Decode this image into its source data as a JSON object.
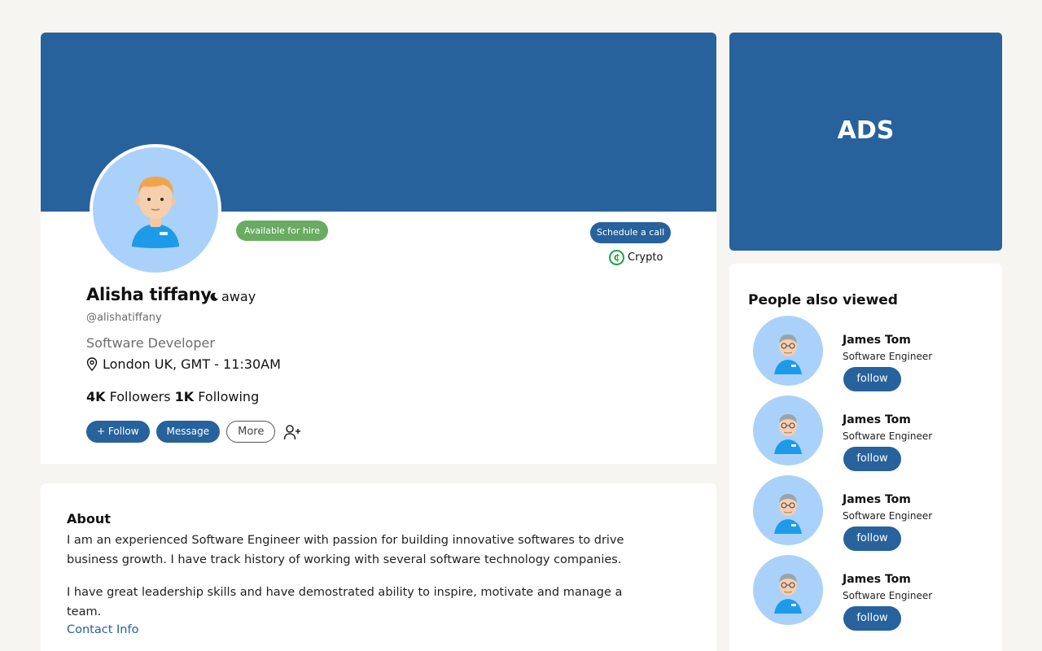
{
  "profile": {
    "hire_badge": "Available for hire",
    "schedule_label": "Schedule a call",
    "crypto_label": "Crypto",
    "name": "Alisha tiffany",
    "status": "away",
    "handle": "@alishatiffany",
    "title": "Software Developer",
    "location": "London UK, GMT - 11:30AM",
    "followers_count": "4K",
    "followers_label": "Followers",
    "following_count": "1K",
    "following_label": "Following",
    "follow_label": "+ Follow",
    "message_label": "Message",
    "more_label": "More"
  },
  "about": {
    "heading": "About",
    "paragraph1": "I am an experienced Software Engineer with passion for building innovative softwares to drive business growth. I have track history of working with several software technology companies.",
    "paragraph2": "I have great leadership skills and have demostrated ability to inspire, motivate and manage a team.",
    "contact_link": "Contact Info"
  },
  "ads": {
    "label": "ADS"
  },
  "people": {
    "heading": "People also viewed",
    "items": [
      {
        "name": "James Tom",
        "role": "Software Engineer",
        "follow_label": "follow"
      },
      {
        "name": "James Tom",
        "role": "Software Engineer",
        "follow_label": "follow"
      },
      {
        "name": "James Tom",
        "role": "Software Engineer",
        "follow_label": "follow"
      },
      {
        "name": "James Tom",
        "role": "Software Engineer",
        "follow_label": "follow"
      }
    ]
  },
  "colors": {
    "brand": "#27629c",
    "hire_badge": "#6aab62",
    "crypto": "#22a345",
    "avatar_bg": "#aad1fa"
  },
  "icons": [
    "away-moon-icon",
    "crypto-coin-icon",
    "location-pin-icon",
    "add-user-icon"
  ]
}
